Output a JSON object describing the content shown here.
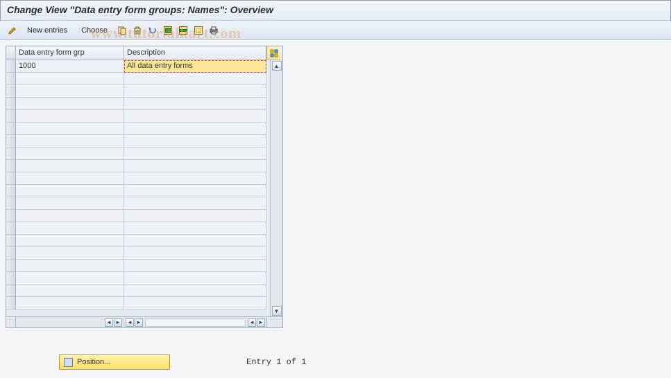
{
  "title": "Change View \"Data entry form groups: Names\": Overview",
  "toolbar": {
    "new_entries_label": "New entries",
    "choose_label": "Choose"
  },
  "watermark": "www.tutorialkart.com",
  "table": {
    "columns": {
      "c1": "Data entry form grp",
      "c2": "Description"
    },
    "row_count_visible": 20,
    "rows": [
      {
        "c1": "1000",
        "c2": "All data entry forms",
        "c2_selected": true
      }
    ]
  },
  "footer": {
    "position_label": "Position...",
    "entry_status": "Entry 1 of 1"
  }
}
